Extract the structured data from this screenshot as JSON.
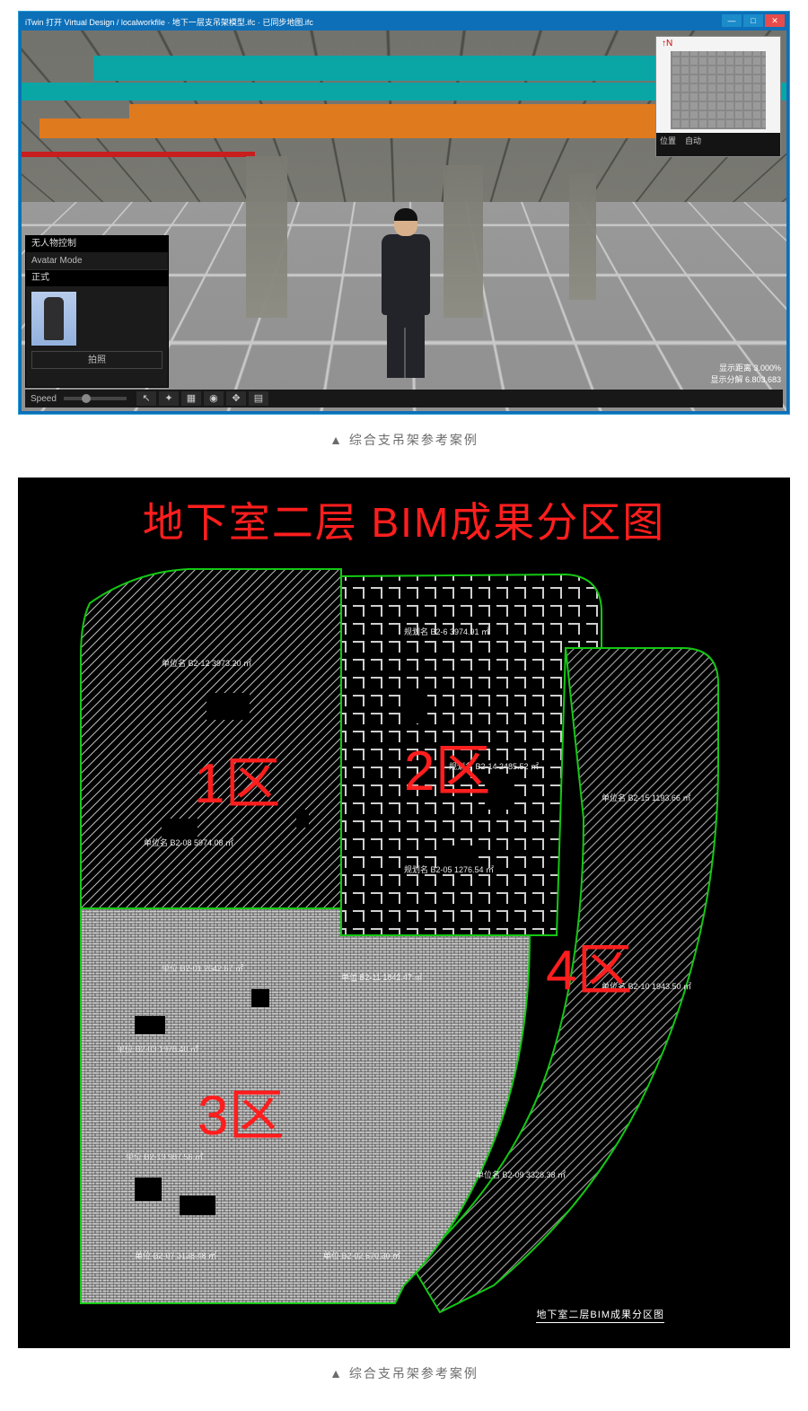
{
  "captions": {
    "top": "▲ 综合支吊架参考案例",
    "bottom": "▲ 综合支吊架参考案例"
  },
  "bim": {
    "window_title": "iTwin 打开 Virtual Design / localworkfile · 地下一层支吊架模型.ifc · 已同步地图.ifc",
    "window_buttons": {
      "min": "—",
      "max": "□",
      "close": "✕"
    },
    "left_panel": {
      "header": "无人物控制",
      "mode_label": "Avatar Mode",
      "section_label": "正式",
      "thumb_caption": "",
      "button_label": "拍照"
    },
    "toolbar": {
      "speed_label": "Speed",
      "icons": [
        "cursor-icon",
        "compass-icon",
        "cube-icon",
        "eye-icon",
        "move-icon",
        "book-icon"
      ]
    },
    "minimap": {
      "compass": "N",
      "btn1": "位置",
      "btn2": "自动"
    },
    "status": {
      "line1": "显示距离  3.000%",
      "line2": "显示分解  6.803.683"
    }
  },
  "cad": {
    "title": "地下室二层 BIM成果分区图",
    "footer": "地下室二层BIM成果分区图",
    "zones": {
      "z1": "1区",
      "z2": "2区",
      "z3": "3区",
      "z4": "4区"
    },
    "annotations": {
      "z1a": "单位名   B2-12   3973.20 ㎡",
      "z1b": "单位名   B2-08   5974.08 ㎡",
      "z2a": "规划名  B2-6   3974.91 ㎡",
      "z2b": "规划名  B2-14  2485.52 ㎡",
      "z2c": "规划名  B2-05  1276.54 ㎡",
      "z3a": "单位   B2-01  2642.67 ㎡",
      "z3b": "单位   B2-03  1978.40 ㎡",
      "z3c": "单位   B2-13   987.56 ㎡",
      "z3d": "单位   B2-07  3138.48 ㎡",
      "z3e": "单位   B2-11  1842.47 ㎡",
      "z3f": "单位   B2-02   670.30 ㎡",
      "z4a": "单位名  B2-15  1193.66 ㎡",
      "z4b": "单位名  B2-10  1943.50 ㎡",
      "z4c": "单位名  B2-09  3328.38 ㎡"
    }
  }
}
